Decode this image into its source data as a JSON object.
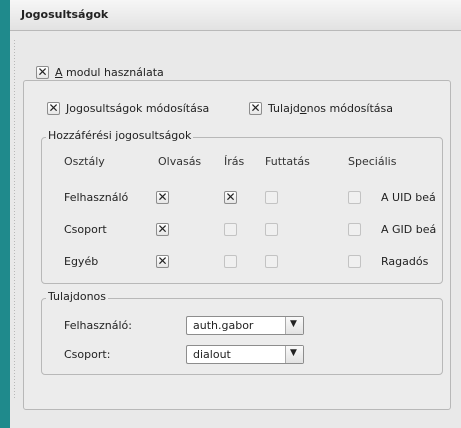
{
  "title": "Jogosultságok",
  "enable_module": {
    "checked": true,
    "prefix": "A",
    "rest": " modul használata"
  },
  "options": {
    "modify_permissions": {
      "checked": true,
      "prefix": "J",
      "rest": "ogosultságok módosítása"
    },
    "modify_owner": {
      "checked": true,
      "pre": "Tulajd",
      "ul": "o",
      "post": "nos módosítása"
    }
  },
  "access": {
    "legend": "Hozzáférési jogosultságok",
    "columns": [
      "Osztály",
      "Olvasás",
      "Írás",
      "Futtatás",
      "Speciális"
    ],
    "rows": [
      {
        "label": "Felhasználó",
        "read": true,
        "write": true,
        "exec": false,
        "special": false,
        "special_label": "A UID beá"
      },
      {
        "label": "Csoport",
        "read": true,
        "write": false,
        "exec": false,
        "special": false,
        "special_label": "A GID beá"
      },
      {
        "label": "Egyéb",
        "read": true,
        "write": false,
        "exec": false,
        "special": false,
        "special_label": "Ragadós"
      }
    ]
  },
  "owner": {
    "legend": "Tulajdonos",
    "user_label": "Felhasználó:",
    "user_value": "auth.gabor",
    "group_label": "Csoport:",
    "group_value": "dialout"
  },
  "icons": {
    "dropdown": "chevron-down-icon",
    "check": "x-check-icon"
  }
}
